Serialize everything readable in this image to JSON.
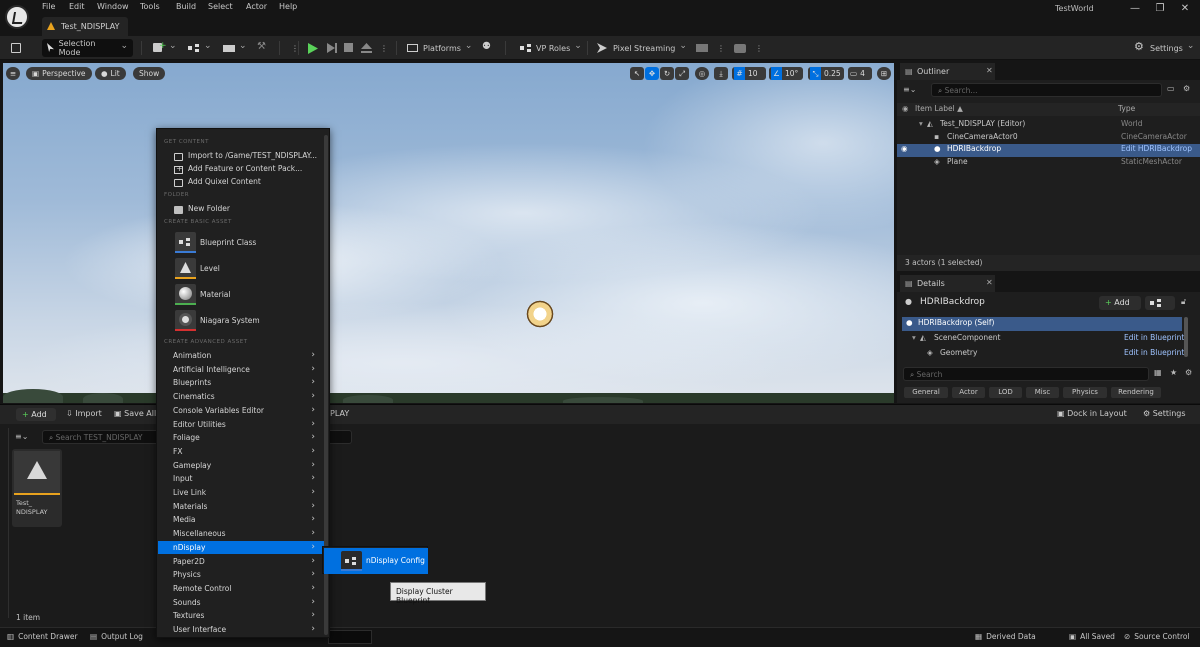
{
  "menubar": {
    "items": [
      "File",
      "Edit",
      "Window",
      "Tools",
      "Build",
      "Select",
      "Actor",
      "Help"
    ]
  },
  "document_tab": {
    "title": "Test_NDISPLAY"
  },
  "world_name": "TestWorld",
  "window_controls": {
    "minimize": "—",
    "maximize": "❐",
    "close": "✕"
  },
  "toolbar": {
    "selection_mode": "Selection Mode",
    "platforms": "Platforms",
    "vp_roles": "VP Roles",
    "pixel_streaming": "Pixel Streaming",
    "settings": "Settings"
  },
  "viewport": {
    "perspective": "Perspective",
    "lit": "Lit",
    "show": "Show",
    "grid_snap": "10",
    "rotation_snap": "10°",
    "scale_snap": "0.25",
    "camera_speed": "4"
  },
  "outliner": {
    "tab": "Outliner",
    "search_placeholder": "Search...",
    "col_label": "Item Label ▲",
    "col_type": "Type",
    "rows": [
      {
        "label": "Test_NDISPLAY (Editor)",
        "type": "World"
      },
      {
        "label": "CineCameraActor0",
        "type": "CineCameraActor"
      },
      {
        "label": "HDRIBackdrop",
        "type": "Edit HDRIBackdrop"
      },
      {
        "label": "Plane",
        "type": "StaticMeshActor"
      }
    ],
    "status": "3 actors (1 selected)"
  },
  "details": {
    "tab": "Details",
    "actor_name": "HDRIBackdrop",
    "add_label": "Add",
    "components": [
      {
        "label": "HDRIBackdrop (Self)",
        "link": ""
      },
      {
        "label": "SceneComponent",
        "link": "Edit in Blueprint"
      },
      {
        "label": "Geometry",
        "link": "Edit in Blueprint"
      }
    ],
    "search_placeholder": "Search",
    "categories": [
      "General",
      "Actor",
      "LOD",
      "Misc",
      "Physics",
      "Rendering"
    ]
  },
  "content_drawer": {
    "add": "Add",
    "import": "Import",
    "save_all": "Save All",
    "path_tail": "PLAY",
    "search_placeholder": "Search TEST_NDISPLAY",
    "dock_in_layout": "Dock in Layout",
    "settings": "Settings",
    "asset_label": "Test_ NDISPLAY",
    "item_count": "1 item"
  },
  "statusbar": {
    "content_drawer": "Content Drawer",
    "output_log": "Output Log",
    "derived_data": "Derived Data",
    "all_saved": "All Saved",
    "source_control": "Source Control"
  },
  "context_menu": {
    "sections": {
      "get_content": "GET CONTENT",
      "folder": "FOLDER",
      "basic": "CREATE BASIC ASSET",
      "advanced": "CREATE ADVANCED ASSET"
    },
    "get_content_items": [
      "Import to /Game/TEST_NDISPLAY...",
      "Add Feature or Content Pack...",
      "Add Quixel Content"
    ],
    "folder_items": [
      "New Folder"
    ],
    "basic_items": [
      {
        "label": "Blueprint Class",
        "color": "#3a7bd5"
      },
      {
        "label": "Level",
        "color": "#e8a21e"
      },
      {
        "label": "Material",
        "color": "#4caf50"
      },
      {
        "label": "Niagara System",
        "color": "#d63030"
      }
    ],
    "advanced_items": [
      "Animation",
      "Artificial Intelligence",
      "Blueprints",
      "Cinematics",
      "Console Variables Editor",
      "Editor Utilities",
      "Foliage",
      "FX",
      "Gameplay",
      "Input",
      "Live Link",
      "Materials",
      "Media",
      "Miscellaneous",
      "nDisplay",
      "Paper2D",
      "Physics",
      "Remote Control",
      "Sounds",
      "Textures",
      "User Interface"
    ],
    "selected": "nDisplay"
  },
  "submenu": {
    "item": "nDisplay Config"
  },
  "tooltip": {
    "text": "Display Cluster Blueprint"
  },
  "colors": {
    "accent": "#0070e0",
    "selection": "#3a5a8a",
    "play": "#5ad25a"
  }
}
